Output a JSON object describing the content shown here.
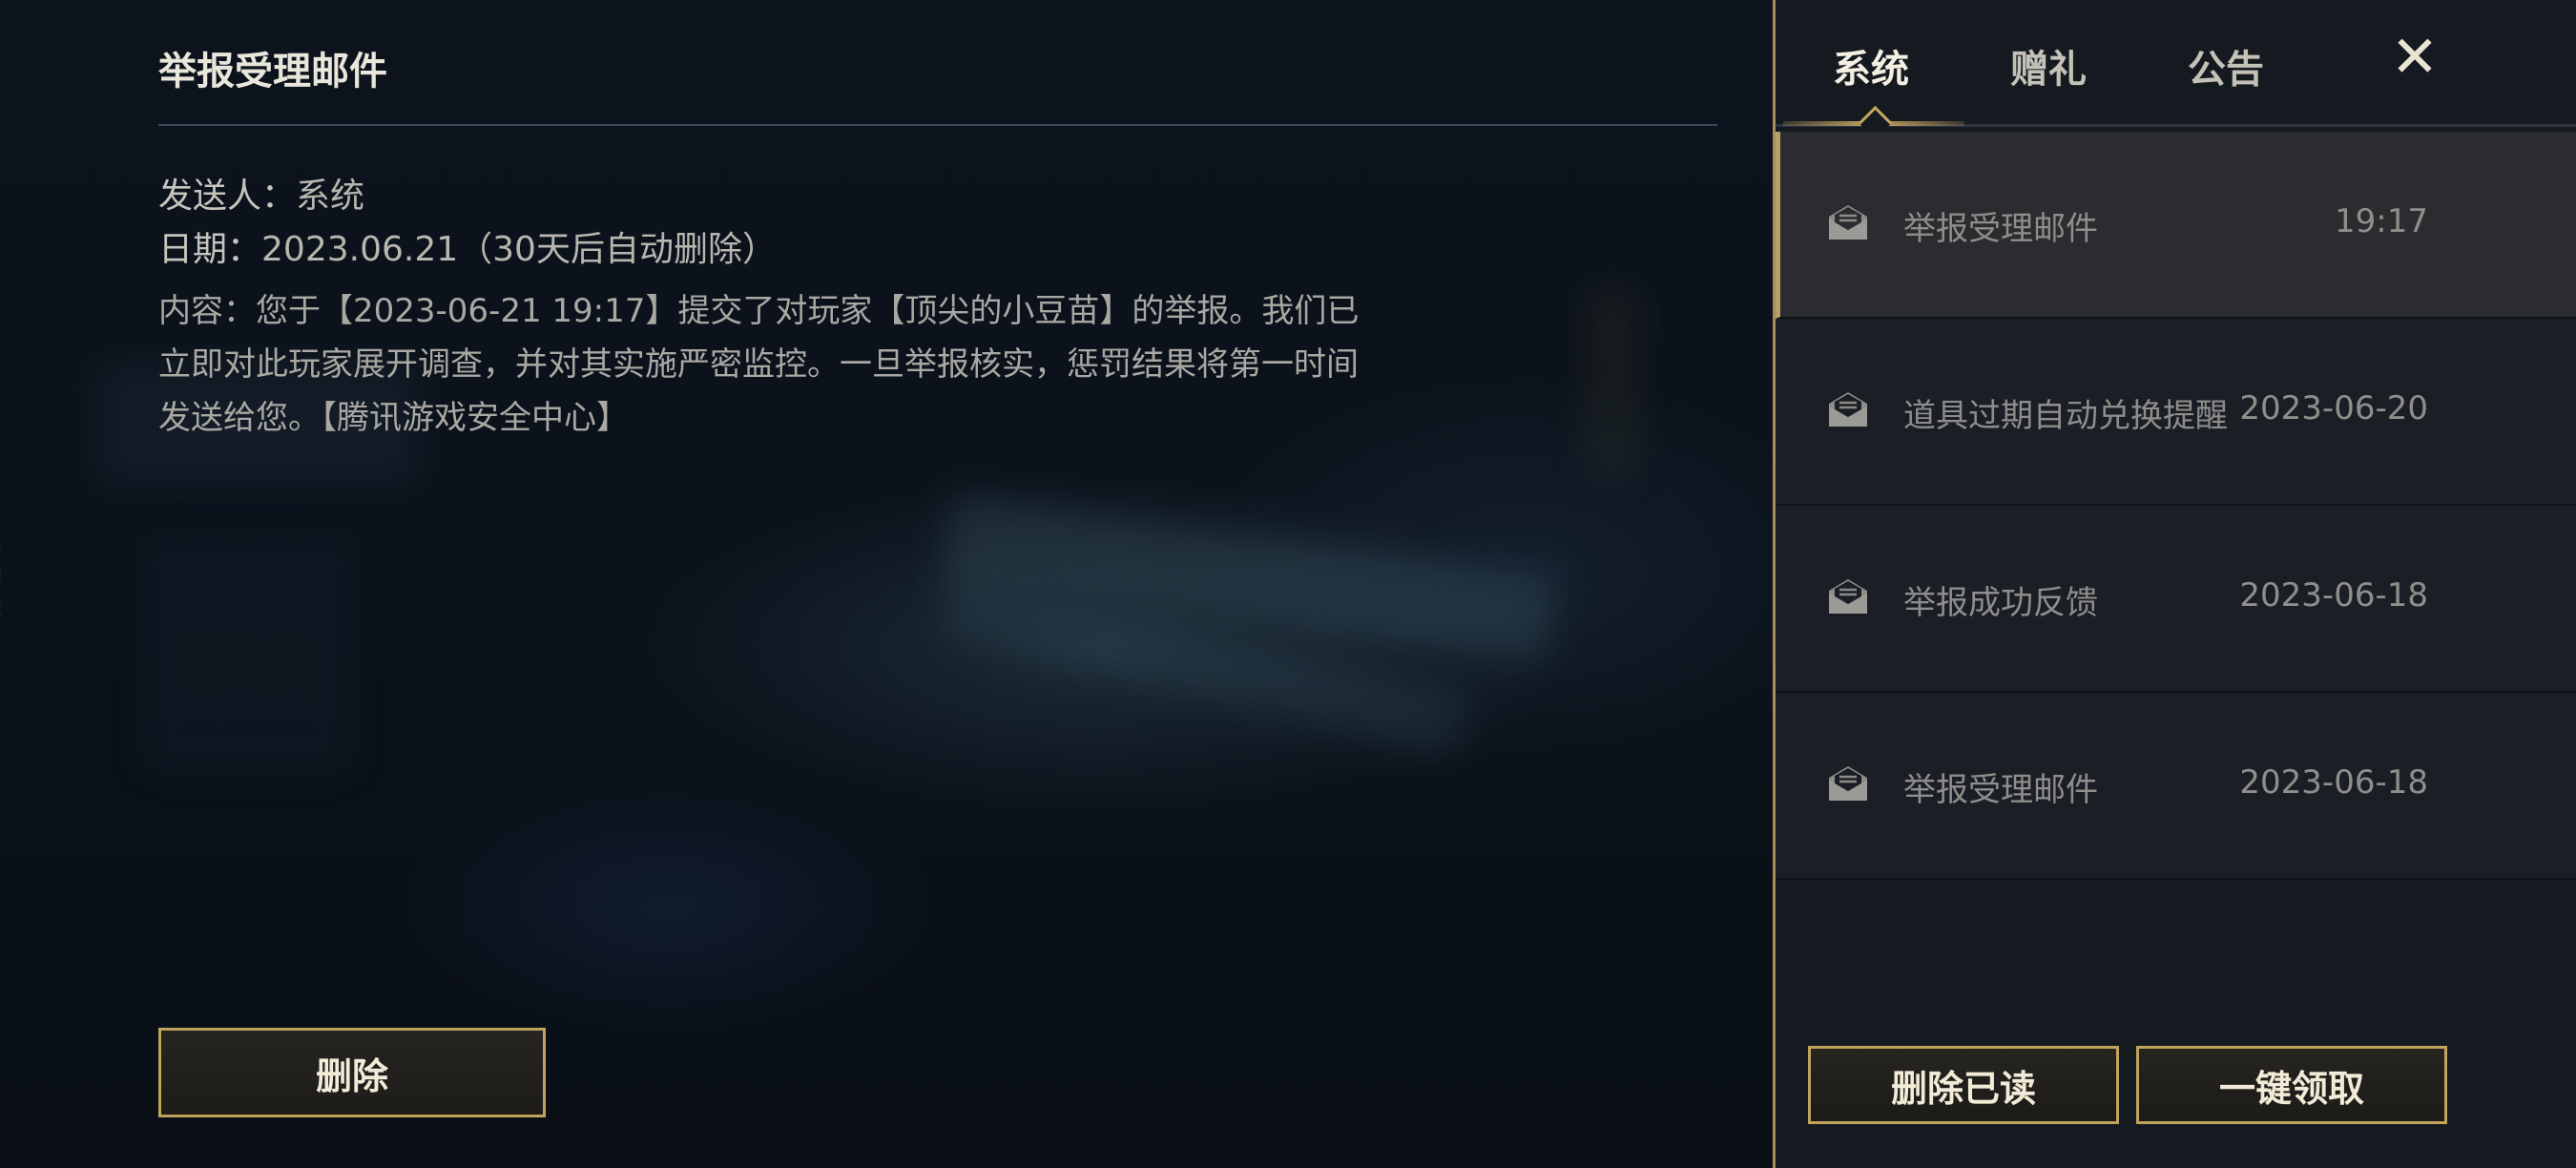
{
  "detail": {
    "title": "举报受理邮件",
    "sender_label": "发送人：",
    "sender_value": "系统",
    "date_label": "日期：",
    "date_value": "2023.06.21（30天后自动删除）",
    "content": "内容：您于【2023-06-21 19:17】提交了对玩家【顶尖的小豆苗】的举报。我们已立即对此玩家展开调查，并对其实施严密监控。一旦举报核实，惩罚结果将第一时间发送给您。【腾讯游戏安全中心】",
    "delete_label": "删除"
  },
  "side_id": "41959836",
  "tabs": {
    "items": [
      {
        "label": "系统",
        "active": true
      },
      {
        "label": "赠礼",
        "active": false
      },
      {
        "label": "公告",
        "active": false
      }
    ],
    "close_icon": "close-icon"
  },
  "mail_list": [
    {
      "subject": "举报受理邮件",
      "time": "19:17",
      "selected": true,
      "icon": "opened-envelope-icon"
    },
    {
      "subject": "道具过期自动兑换提醒",
      "time": "2023-06-20",
      "selected": false,
      "icon": "opened-envelope-icon"
    },
    {
      "subject": "举报成功反馈",
      "time": "2023-06-18",
      "selected": false,
      "icon": "opened-envelope-icon"
    },
    {
      "subject": "举报受理邮件",
      "time": "2023-06-18",
      "selected": false,
      "icon": "opened-envelope-icon"
    }
  ],
  "actions": {
    "delete_read_label": "删除已读",
    "claim_all_label": "一键领取"
  },
  "colors": {
    "accent_gold": "#c0a35c",
    "panel_bg": "#151a20",
    "selected_bg": "#2a2c2f"
  }
}
